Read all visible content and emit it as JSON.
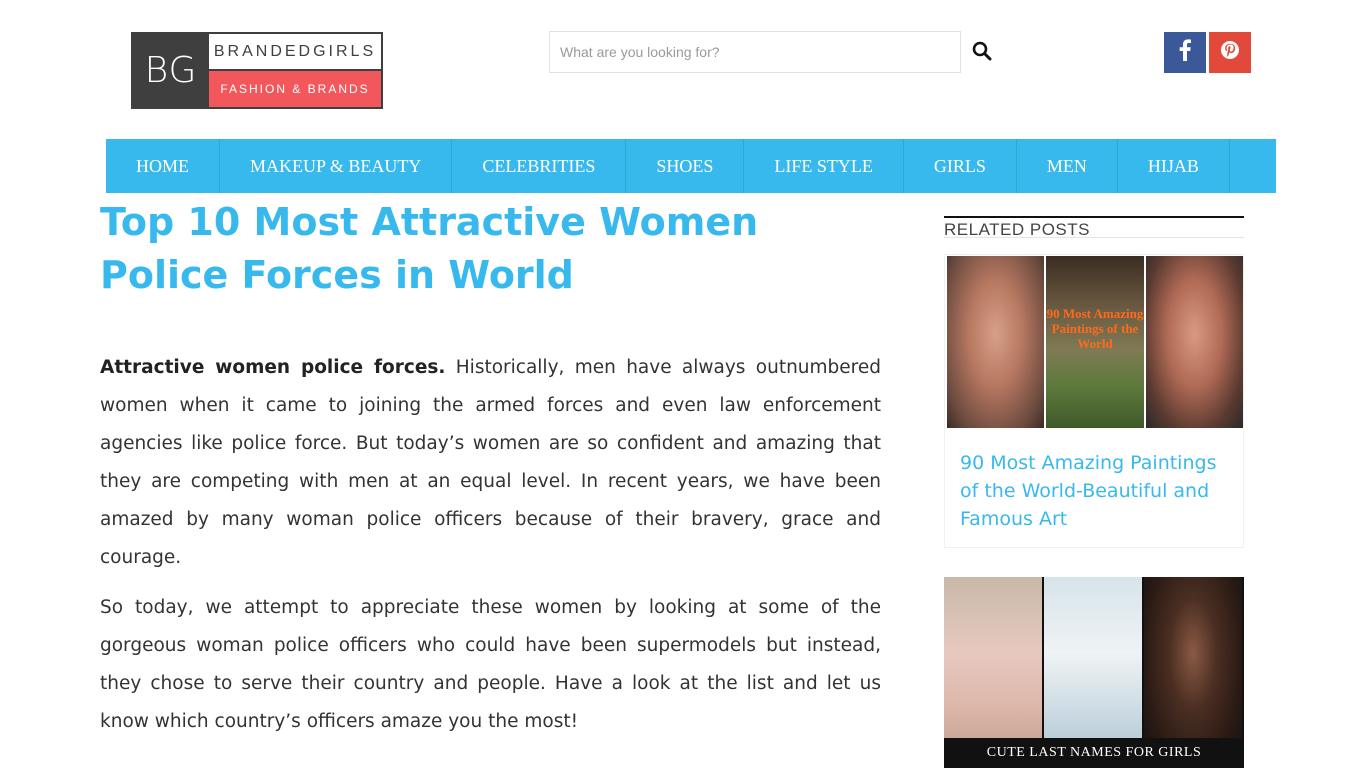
{
  "header": {
    "logo": {
      "initials": "BG",
      "name": "BRANDEDGIRLS",
      "tagline": "FASHION & BRANDS"
    },
    "search": {
      "placeholder": "What are you looking for?",
      "value": ""
    },
    "social": [
      {
        "name": "facebook",
        "icon": "facebook-icon",
        "color": "#3b5998"
      },
      {
        "name": "pinterest",
        "icon": "pinterest-icon",
        "color": "#e2493b"
      }
    ]
  },
  "nav": {
    "items": [
      "HOME",
      "MAKEUP & BEAUTY",
      "CELEBRITIES",
      "SHOES",
      "LIFE STYLE",
      "GIRLS",
      "MEN",
      "HIJAB"
    ]
  },
  "article": {
    "title": "Top 10 Most Attractive Women Police Forces in World",
    "p1_bold": "Attractive women police forces.",
    "p1_text": " Historically, men have always outnumbered women when it came to joining the armed forces and even law enforcement agencies like police force. But today’s women are so confident and amazing that they are competing with men at an equal level. In recent years, we have been amazed by many woman police officers because of their bravery, grace and courage.",
    "p2_text": "So today, we attempt to appreciate these women by looking at some of the gorgeous woman police officers who could have been supermodels but instead, they chose to serve their country and people. Have a look at the list and let us know which country’s officers amaze you the most!"
  },
  "sidebar": {
    "heading": "RELATED POSTS",
    "posts": [
      {
        "title": "90 Most Amazing Paintings of the World-Beautiful and Famous Art",
        "image_text": "90 Most Amazing Paintings of the World"
      },
      {
        "title": "",
        "image_caption": "CUTE LAST NAMES FOR GIRLS"
      }
    ]
  },
  "colors": {
    "accent": "#37b9ee",
    "logo_red": "#f2585b",
    "logo_dark": "#3f3f3f"
  }
}
